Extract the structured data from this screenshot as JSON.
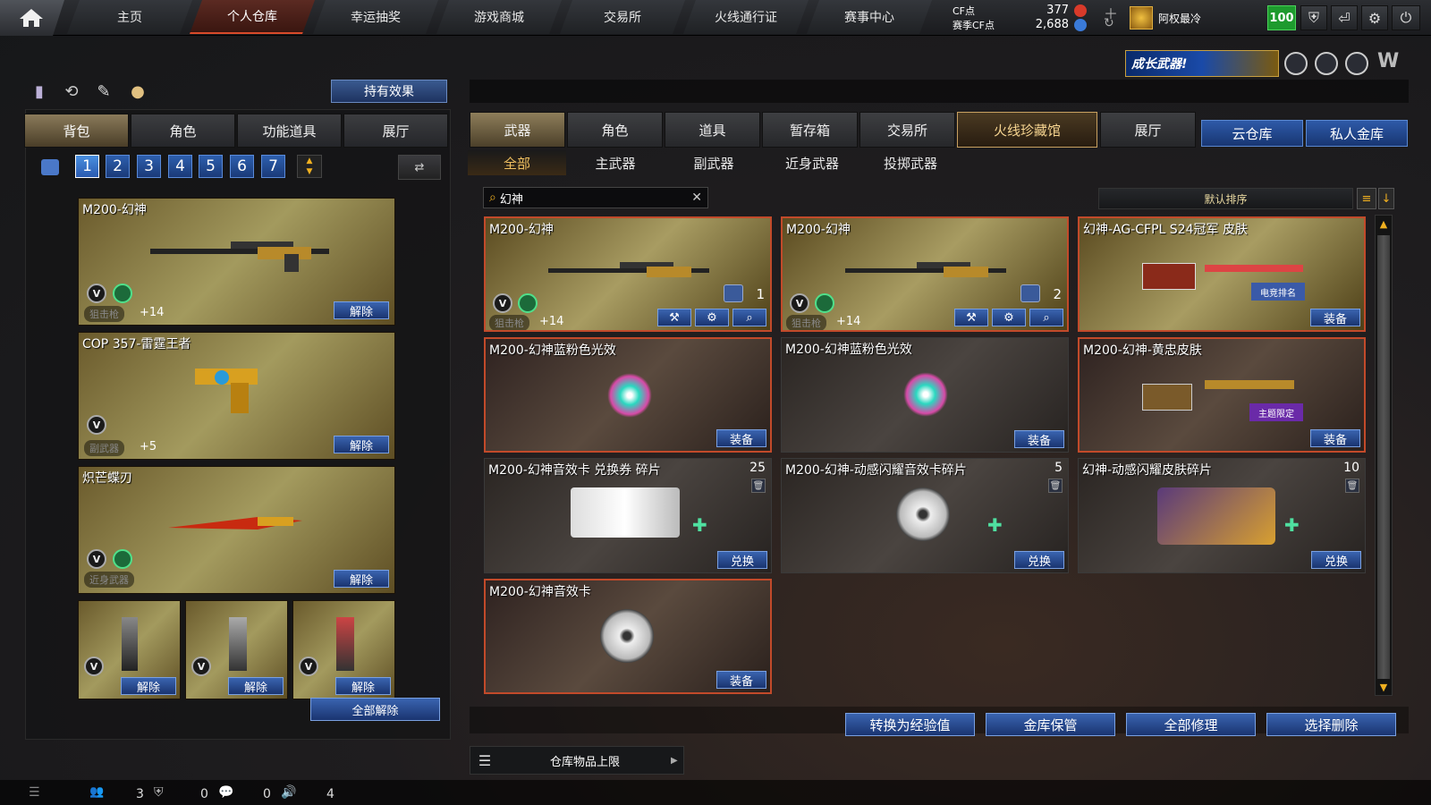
{
  "nav": {
    "tabs": [
      "主页",
      "个人仓库",
      "幸运抽奖",
      "游戏商城",
      "交易所",
      "火线通行证",
      "赛事中心"
    ],
    "active_tab": "个人仓库",
    "cf_label": "CF点",
    "cf_value": "377",
    "season_cf_label": "赛季CF点",
    "season_cf_value": "2,688",
    "username": "阿权最冷",
    "level": "100"
  },
  "banner": {
    "text": "成长武器!"
  },
  "left": {
    "hold_effect_label": "持有效果",
    "tabs": [
      "背包",
      "角色",
      "功能道具",
      "展厅"
    ],
    "pages": [
      "1",
      "2",
      "3",
      "4",
      "5",
      "6",
      "7"
    ],
    "items": [
      {
        "name": "M200-幻神",
        "type": "狙击枪",
        "plus": "+14",
        "action": "解除"
      },
      {
        "name": "COP 357-雷霆王者",
        "type": "副武器",
        "plus": "+5",
        "action": "解除"
      },
      {
        "name": "炽芒蝶刃",
        "type": "近身武器",
        "plus": "",
        "action": "解除"
      }
    ],
    "grenades": [
      {
        "action": "解除"
      },
      {
        "action": "解除"
      },
      {
        "action": "解除"
      }
    ],
    "unequip_all": "全部解除"
  },
  "right": {
    "tabs": [
      "武器",
      "角色",
      "道具",
      "暂存箱",
      "交易所",
      "火线珍藏馆",
      "展厅"
    ],
    "cloud_tabs": [
      "云仓库",
      "私人金库"
    ],
    "subtabs": [
      "全部",
      "主武器",
      "副武器",
      "近身武器",
      "投掷武器"
    ],
    "search": {
      "value": "幻神"
    },
    "sort_label": "默认排序",
    "cards": [
      {
        "title": "M200-幻神",
        "count": "",
        "type": "狙击枪",
        "plus": "+14",
        "bag": "1",
        "action": ""
      },
      {
        "title": "M200-幻神",
        "count": "",
        "type": "狙击枪",
        "plus": "+14",
        "bag": "2",
        "action": ""
      },
      {
        "title": "幻神-AG-CFPL S24冠军 皮肤",
        "count": "",
        "action": "装备",
        "stamp": "电竞排名"
      },
      {
        "title": "M200-幻神蓝粉色光效",
        "count": "",
        "action": "装备"
      },
      {
        "title": "M200-幻神蓝粉色光效",
        "count": "",
        "action": "装备"
      },
      {
        "title": "M200-幻神-黄忠皮肤",
        "count": "",
        "action": "装备",
        "stamp": "主题限定"
      },
      {
        "title": "M200-幻神音效卡 兑换券 碎片",
        "count": "25",
        "action": "兑换"
      },
      {
        "title": "M200-幻神-动感闪耀音效卡碎片",
        "count": "5",
        "action": "兑换"
      },
      {
        "title": "幻神-动感闪耀皮肤碎片",
        "count": "10",
        "action": "兑换"
      },
      {
        "title": "M200-幻神音效卡",
        "count": "",
        "action": "装备"
      }
    ],
    "actions": [
      "转换为经验值",
      "金库保管",
      "全部修理",
      "选择删除"
    ],
    "capacity_label": "仓库物品上限"
  },
  "status": {
    "v1": "3",
    "v2": "0",
    "v3": "0",
    "v4": "4"
  }
}
